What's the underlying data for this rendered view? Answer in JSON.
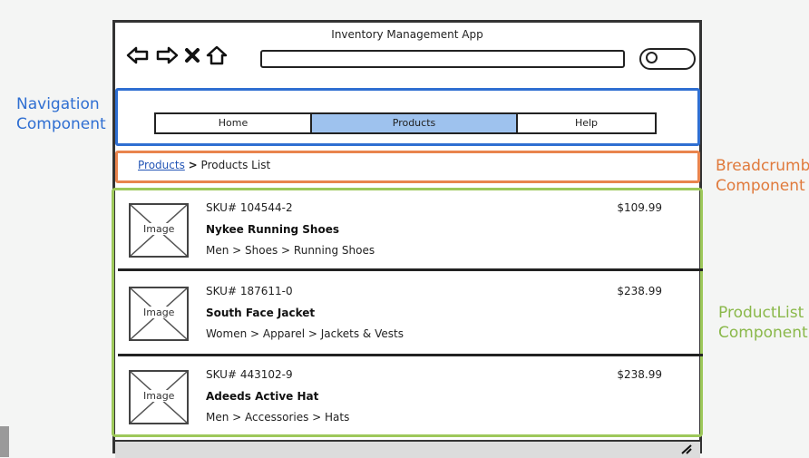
{
  "window": {
    "title": "Inventory Management App"
  },
  "nav": {
    "tabs": [
      "Home",
      "Products",
      "Help"
    ],
    "active": "Products"
  },
  "breadcrumbs": {
    "link": "Products",
    "separator": ">",
    "current": "Products List"
  },
  "products": [
    {
      "image_label": "Image",
      "sku": "SKU# 104544-2",
      "name": "Nykee Running Shoes",
      "category": "Men > Shoes > Running Shoes",
      "price": "$109.99"
    },
    {
      "image_label": "Image",
      "sku": "SKU# 187611-0",
      "name": "South Face Jacket",
      "category": "Women > Apparel > Jackets & Vests",
      "price": "$238.99"
    },
    {
      "image_label": "Image",
      "sku": "SKU# 443102-9",
      "name": "Adeeds Active Hat",
      "category": "Men > Accessories > Hats",
      "price": "$238.99"
    }
  ],
  "annotations": {
    "navigation": [
      "Navigation",
      "Component"
    ],
    "breadcrumbs": [
      "Breadcrumbs",
      "Component"
    ],
    "productlist": [
      "ProductList",
      "Component"
    ]
  },
  "colors": {
    "navigation": "#2f6fd2",
    "breadcrumbs": "#e9844d",
    "productlist": "#9dc85a",
    "active_tab": "#9ec2ee"
  },
  "icons": [
    "back-arrow-icon",
    "forward-arrow-icon",
    "close-icon",
    "home-icon",
    "search-icon",
    "resize-grip-icon"
  ]
}
